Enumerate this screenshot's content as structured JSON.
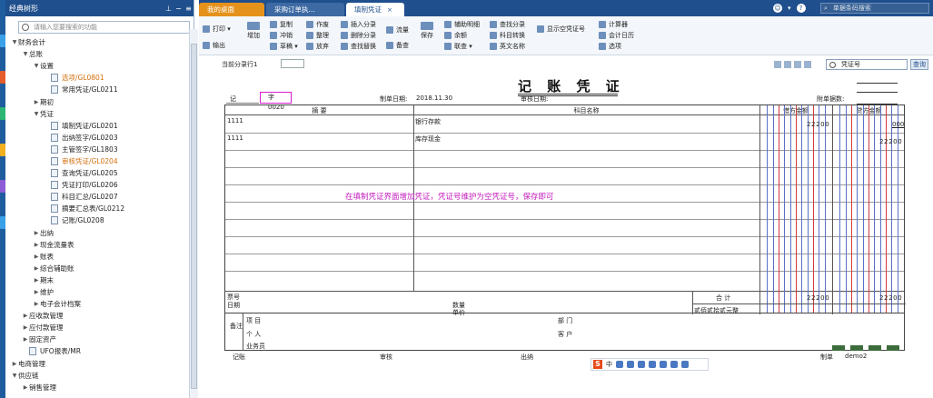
{
  "tree": {
    "title": "经典树形",
    "search_placeholder": "请输入您要搜索的功能",
    "items": [
      {
        "label": "财务会计",
        "level": 0,
        "type": "folder",
        "expanded": true
      },
      {
        "label": "总账",
        "level": 1,
        "type": "folder",
        "expanded": true
      },
      {
        "label": "设置",
        "level": 2,
        "type": "folder",
        "expanded": true
      },
      {
        "label": "选项/GL0801",
        "level": 3,
        "type": "doc",
        "selected": true
      },
      {
        "label": "常用凭证/GL0211",
        "level": 3,
        "type": "doc"
      },
      {
        "label": "期初",
        "level": 2,
        "type": "folder",
        "expanded": false
      },
      {
        "label": "凭证",
        "level": 2,
        "type": "folder",
        "expanded": true
      },
      {
        "label": "填制凭证/GL0201",
        "level": 3,
        "type": "doc"
      },
      {
        "label": "出纳签字/GL0203",
        "level": 3,
        "type": "doc"
      },
      {
        "label": "主管签字/GL1803",
        "level": 3,
        "type": "doc"
      },
      {
        "label": "审核凭证/GL0204",
        "level": 3,
        "type": "doc",
        "selected": true
      },
      {
        "label": "查询凭证/GL0205",
        "level": 3,
        "type": "doc"
      },
      {
        "label": "凭证打印/GL0206",
        "level": 3,
        "type": "doc"
      },
      {
        "label": "科目汇总/GL0207",
        "level": 3,
        "type": "doc"
      },
      {
        "label": "摘要汇总表/GL0212",
        "level": 3,
        "type": "doc"
      },
      {
        "label": "记账/GL0208",
        "level": 3,
        "type": "doc"
      },
      {
        "label": "出纳",
        "level": 2,
        "type": "folder",
        "expanded": false
      },
      {
        "label": "现金流量表",
        "level": 2,
        "type": "folder",
        "expanded": false
      },
      {
        "label": "账表",
        "level": 2,
        "type": "folder",
        "expanded": false
      },
      {
        "label": "综合辅助账",
        "level": 2,
        "type": "folder",
        "expanded": false
      },
      {
        "label": "期末",
        "level": 2,
        "type": "folder",
        "expanded": false
      },
      {
        "label": "维护",
        "level": 2,
        "type": "folder",
        "expanded": false
      },
      {
        "label": "电子会计档案",
        "level": 2,
        "type": "folder",
        "expanded": false
      },
      {
        "label": "应收款管理",
        "level": 1,
        "type": "folder",
        "expanded": false
      },
      {
        "label": "应付款管理",
        "level": 1,
        "type": "folder",
        "expanded": false
      },
      {
        "label": "固定资产",
        "level": 1,
        "type": "folder",
        "expanded": false
      },
      {
        "label": "UFO报表/MR",
        "level": 1,
        "type": "doc"
      },
      {
        "label": "电商管理",
        "level": 0,
        "type": "folder",
        "expanded": false
      },
      {
        "label": "供应链",
        "level": 0,
        "type": "folder",
        "expanded": true
      },
      {
        "label": "销售管理",
        "level": 1,
        "type": "folder",
        "expanded": false
      }
    ]
  },
  "tabs": [
    {
      "label": "我的桌面"
    },
    {
      "label": "采购订单执..."
    },
    {
      "label": "填制凭证"
    }
  ],
  "help_search_placeholder": "单据条码搜索",
  "toolbar": {
    "print": "打印",
    "export": "输出",
    "add": "增加",
    "copy": "复制",
    "reverse": "冲销",
    "draft": "草稿",
    "void": "作废",
    "tidy": "整理",
    "discard": "放弃",
    "insert_entry": "插入分录",
    "delete_entry": "删除分录",
    "find_replace": "查找替换",
    "flow": "流量",
    "memo": "备查",
    "save": "保存",
    "aux_detail": "辅助明细",
    "balance": "余额",
    "link_query": "联查",
    "find_entry": "查找分录",
    "account_convert": "科目转换",
    "english_name": "英文名称",
    "show_empty_no": "显示空凭证号",
    "calculator": "计算器",
    "calendar": "会计日历",
    "options": "选项"
  },
  "subbar": {
    "current_entry_label": "当前分录行1",
    "search_field": "凭证号",
    "query_button": "查询"
  },
  "voucher": {
    "title": "记 账 凭 证",
    "type_prefix": "记",
    "number": "字 0020",
    "date_label": "制单日期:",
    "date_value": "2018.11.30",
    "audit_date_label": "审核日期:",
    "attachments_label": "附单据数:",
    "col_summary": "摘 要",
    "col_account": "科目名称",
    "col_debit": "借方金额",
    "col_credit": "贷方金额",
    "rows": [
      {
        "summary": "1111",
        "account": "银行存款",
        "debit": "22200",
        "credit": ""
      },
      {
        "summary": "1111",
        "account": "库存现金",
        "debit": "",
        "credit": "22200"
      }
    ],
    "credit_first_row_fragment": "000",
    "bill_no_label": "票号",
    "date_label2": "日期",
    "quantity_label": "数量",
    "unit_price_label": "单价",
    "total_label": "合 计",
    "total_debit": "22200",
    "total_credit": "22200",
    "amount_words": "贰佰贰拾贰元整",
    "remark_label": "备注",
    "project_label": "项 目",
    "department_label": "部 门",
    "person_label": "个 人",
    "customer_label": "客 户",
    "salesman_label": "业务员",
    "bookkeeper_label": "记账",
    "auditor_label": "审核",
    "cashier_label": "出纳",
    "maker_label": "制单",
    "maker_value": "demo2"
  },
  "annotation": "在填制凭证界面增加凭证，凭证号维护为空凭证号，保存即可",
  "ime": {
    "brand": "S",
    "lang": "中"
  },
  "colors": {
    "header": "#1f4f8d",
    "accent_tab": "#e5921c",
    "highlight": "#d61fcf",
    "annotation": "#c41fbd"
  }
}
